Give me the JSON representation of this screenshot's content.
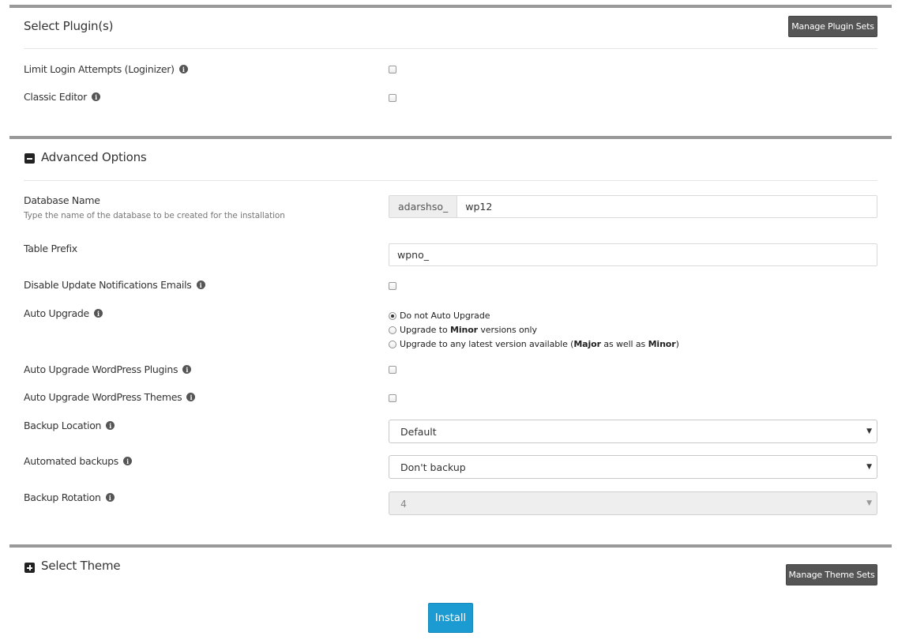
{
  "plugins": {
    "title": "Select Plugin(s)",
    "manage_label": "Manage Plugin Sets",
    "items": [
      {
        "label": "Limit Login Attempts (Loginizer)",
        "checked": false
      },
      {
        "label": "Classic Editor",
        "checked": false
      }
    ]
  },
  "advanced": {
    "title": "Advanced Options",
    "db_name": {
      "label": "Database Name",
      "hint": "Type the name of the database to be created for the installation",
      "prefix": "adarshso_",
      "value": "wp12"
    },
    "table_prefix": {
      "label": "Table Prefix",
      "value": "wpno_"
    },
    "disable_update_emails": {
      "label": "Disable Update Notifications Emails",
      "checked": false
    },
    "auto_upgrade": {
      "label": "Auto Upgrade",
      "options": {
        "none": "Do not Auto Upgrade",
        "minor_pre": "Upgrade to ",
        "minor_bold": "Minor",
        "minor_post": " versions only",
        "latest_pre": "Upgrade to any latest version available (",
        "latest_major": "Major",
        "latest_mid": " as well as ",
        "latest_minor": "Minor",
        "latest_post": ")"
      },
      "selected": "none"
    },
    "auto_upgrade_plugins": {
      "label": "Auto Upgrade WordPress Plugins",
      "checked": false
    },
    "auto_upgrade_themes": {
      "label": "Auto Upgrade WordPress Themes",
      "checked": false
    },
    "backup_location": {
      "label": "Backup Location",
      "value": "Default"
    },
    "automated_backups": {
      "label": "Automated backups",
      "value": "Don't backup"
    },
    "backup_rotation": {
      "label": "Backup Rotation",
      "value": "4"
    }
  },
  "theme": {
    "title": "Select Theme",
    "manage_label": "Manage Theme Sets"
  },
  "install_label": "Install",
  "icons": {
    "info": "i",
    "caret": "▼"
  },
  "colors": {
    "accent": "#1b9bd1",
    "dark_button": "#555555",
    "section_rule": "#999999"
  }
}
